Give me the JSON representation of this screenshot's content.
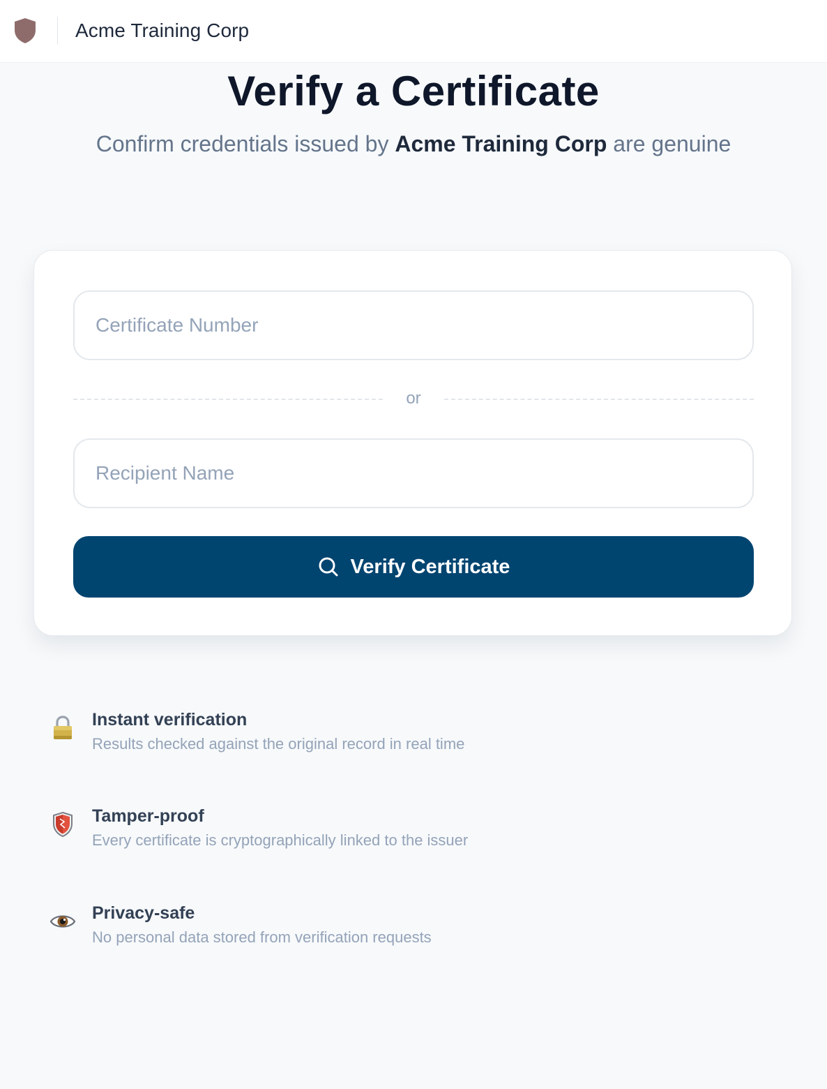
{
  "header": {
    "brand": "Acme Training Corp",
    "logo_icon": "shield-icon",
    "logo_color": "#8f6c6c"
  },
  "hero": {
    "title": "Verify a Certificate",
    "subtitle_prefix": "Confirm credentials issued by ",
    "subtitle_org": "Acme Training Corp",
    "subtitle_suffix": " are genuine"
  },
  "form": {
    "certificate_number": {
      "value": "",
      "placeholder": "Certificate Number"
    },
    "separator": "or",
    "recipient_name": {
      "value": "",
      "placeholder": "Recipient Name"
    },
    "submit": {
      "label": "Verify Certificate",
      "icon": "search-icon",
      "color": "#004470"
    }
  },
  "features": [
    {
      "icon": "lock-icon",
      "title": "Instant verification",
      "description": "Results checked against the original record in real time"
    },
    {
      "icon": "shield-icon",
      "title": "Tamper-proof",
      "description": "Every certificate is cryptographically linked to the issuer"
    },
    {
      "icon": "eye-icon",
      "title": "Privacy-safe",
      "description": "No personal data stored from verification requests"
    }
  ]
}
